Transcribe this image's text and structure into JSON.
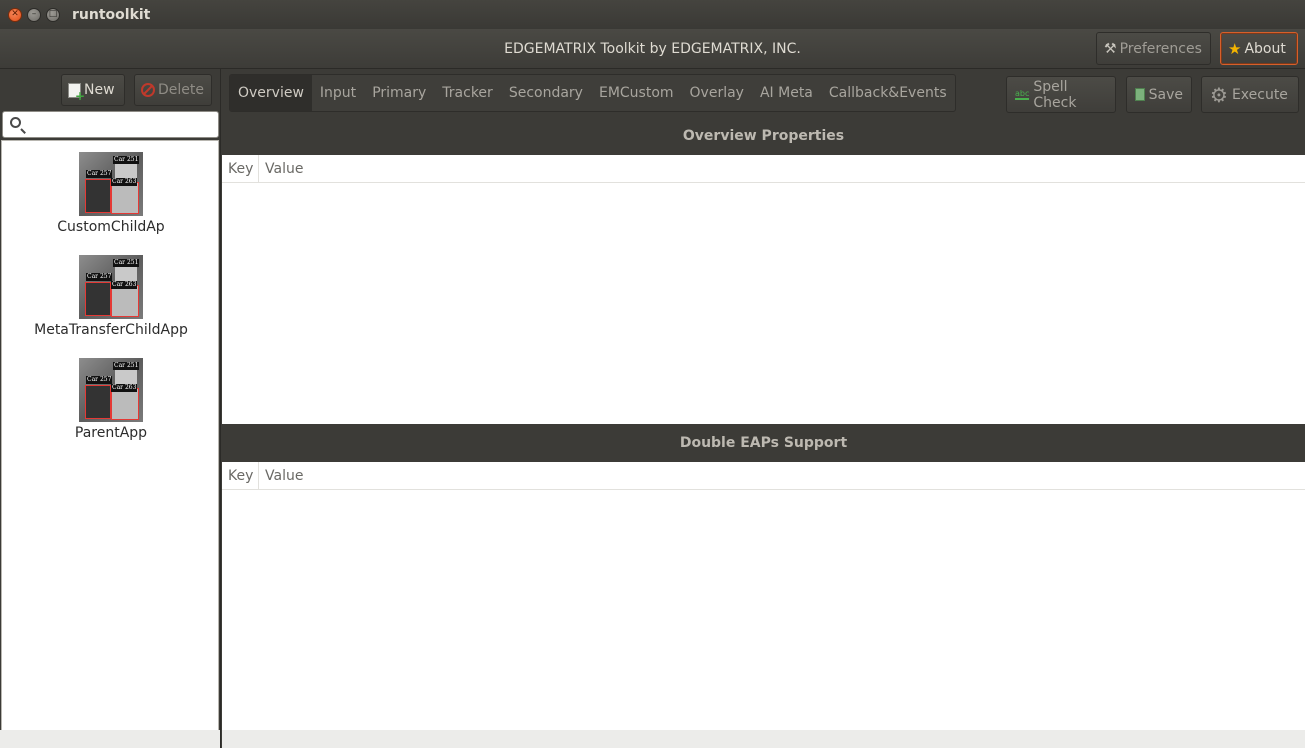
{
  "window": {
    "title": "runtoolkit"
  },
  "header": {
    "title": "EDGEMATRIX Toolkit by EDGEMATRIX, INC.",
    "preferences_label": "Preferences",
    "about_label": "About"
  },
  "sidebar": {
    "new_label": "New",
    "delete_label": "Delete",
    "search_placeholder": "",
    "apps": [
      {
        "label": "CustomChildAp"
      },
      {
        "label": "MetaTransferChildApp"
      },
      {
        "label": "ParentApp"
      }
    ],
    "thumb_tags": [
      "Car 251",
      "Car 257",
      "Car 263"
    ]
  },
  "tabs": [
    {
      "label": "Overview",
      "active": true
    },
    {
      "label": "Input"
    },
    {
      "label": "Primary"
    },
    {
      "label": "Tracker"
    },
    {
      "label": "Secondary"
    },
    {
      "label": "EMCustom"
    },
    {
      "label": "Overlay"
    },
    {
      "label": "AI Meta"
    },
    {
      "label": "Callback&Events"
    }
  ],
  "toolbar": {
    "spell_check_label": "Spell Check",
    "save_label": "Save",
    "execute_label": "Execute"
  },
  "sections": [
    {
      "title": "Overview Properties",
      "columns": [
        "Key",
        "Value"
      ]
    },
    {
      "title": "Double EAPs Support",
      "columns": [
        "Key",
        "Value"
      ]
    }
  ],
  "colors": {
    "accent": "#e25c1e",
    "bg_dark": "#3c3b37",
    "about_border": "#d75f2a"
  }
}
